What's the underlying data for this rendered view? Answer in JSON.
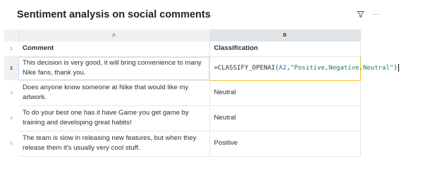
{
  "title": "Sentiment analysis on social comments",
  "toolbar": {
    "filter_icon": "filter-icon",
    "more_label": "···"
  },
  "columns": [
    "A",
    "B"
  ],
  "rows": [
    {
      "num": "1",
      "a": "Comment",
      "b": "Classification"
    },
    {
      "num": "2",
      "a": "This decision is very good, it will bring convenience to many Nike fans, thank you.",
      "b": ""
    },
    {
      "num": "3",
      "a": "Does anyone know someone at Nike that would like my artwork.",
      "b": "Neutral"
    },
    {
      "num": "4",
      "a": "To do your best one has it have Game you get game by training and developing great habits!",
      "b": "Neutral"
    },
    {
      "num": "5",
      "a": "The team is slow in releasing new features, but when they release them it's usually very cool stuff.",
      "b": "Positive"
    }
  ],
  "formula": {
    "prefix": "=CLASSIFY_OPENAI(",
    "ref": "A2",
    "comma": ",",
    "string": "\"Positive,Negative,Neutral\"",
    "suffix": ")"
  },
  "colors": {
    "accent_border": "#f0c233",
    "ref_color": "#1d70d6",
    "string_color": "#18845a"
  }
}
